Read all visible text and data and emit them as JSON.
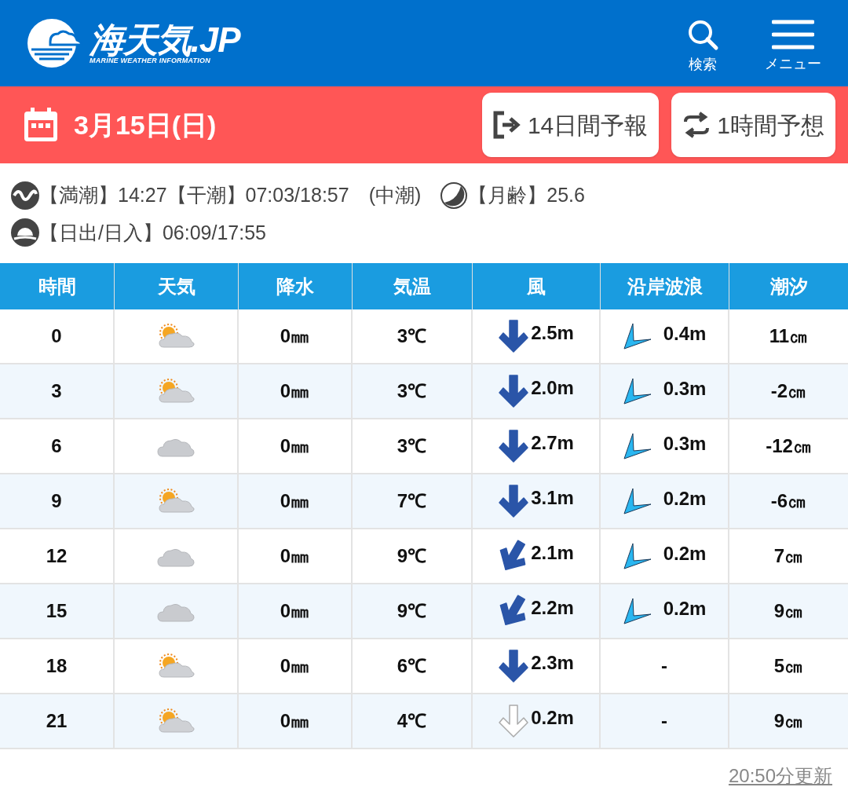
{
  "header": {
    "logo": "海天気.JP",
    "tagline": "MARINE WEATHER INFORMATION",
    "search_label": "検索",
    "menu_label": "メニュー"
  },
  "date_bar": {
    "date": "3月15日(日)",
    "buttons": [
      {
        "label": "14日間予報",
        "kind": "exit"
      },
      {
        "label": "1時間予想",
        "kind": "swap"
      }
    ]
  },
  "info": {
    "tide": "【満潮】14:27【干潮】07:03/18:57　(中潮)",
    "moon": "【月齢】25.6",
    "sun": "【日出/日入】06:09/17:55"
  },
  "table": {
    "columns": [
      "時間",
      "天気",
      "降水",
      "気温",
      "風",
      "沿岸波浪",
      "潮汐"
    ],
    "rows": [
      {
        "time": "0",
        "weather": {
          "kind": "sun_cloud"
        },
        "rain": "0㎜",
        "temp": "3℃",
        "wind": {
          "kind": "down",
          "value": "2.5m"
        },
        "wave": {
          "kind": "arrow",
          "value": "0.4m"
        },
        "tide": "11㎝"
      },
      {
        "time": "3",
        "weather": {
          "kind": "sun_cloud"
        },
        "rain": "0㎜",
        "temp": "3℃",
        "wind": {
          "kind": "down",
          "value": "2.0m"
        },
        "wave": {
          "kind": "arrow",
          "value": "0.3m"
        },
        "tide": "-2㎝"
      },
      {
        "time": "6",
        "weather": {
          "kind": "cloud"
        },
        "rain": "0㎜",
        "temp": "3℃",
        "wind": {
          "kind": "down",
          "value": "2.7m"
        },
        "wave": {
          "kind": "arrow",
          "value": "0.3m"
        },
        "tide": "-12㎝"
      },
      {
        "time": "9",
        "weather": {
          "kind": "sun_cloud"
        },
        "rain": "0㎜",
        "temp": "7℃",
        "wind": {
          "kind": "down",
          "value": "3.1m"
        },
        "wave": {
          "kind": "arrow",
          "value": "0.2m"
        },
        "tide": "-6㎝"
      },
      {
        "time": "12",
        "weather": {
          "kind": "cloud"
        },
        "rain": "0㎜",
        "temp": "9℃",
        "wind": {
          "kind": "downleft",
          "value": "2.1m"
        },
        "wave": {
          "kind": "arrow",
          "value": "0.2m"
        },
        "tide": "7㎝"
      },
      {
        "time": "15",
        "weather": {
          "kind": "cloud"
        },
        "rain": "0㎜",
        "temp": "9℃",
        "wind": {
          "kind": "downleft",
          "value": "2.2m"
        },
        "wave": {
          "kind": "arrow",
          "value": "0.2m"
        },
        "tide": "9㎝"
      },
      {
        "time": "18",
        "weather": {
          "kind": "sun_cloud"
        },
        "rain": "0㎜",
        "temp": "6℃",
        "wind": {
          "kind": "down",
          "value": "2.3m"
        },
        "wave": {
          "value": "-"
        },
        "tide": "5㎝"
      },
      {
        "time": "21",
        "weather": {
          "kind": "sun_cloud"
        },
        "rain": "0㎜",
        "temp": "4℃",
        "wind": {
          "kind": "light",
          "value": "0.2m"
        },
        "wave": {
          "value": "-"
        },
        "tide": "9㎝"
      }
    ]
  },
  "updated": "20:50分更新"
}
